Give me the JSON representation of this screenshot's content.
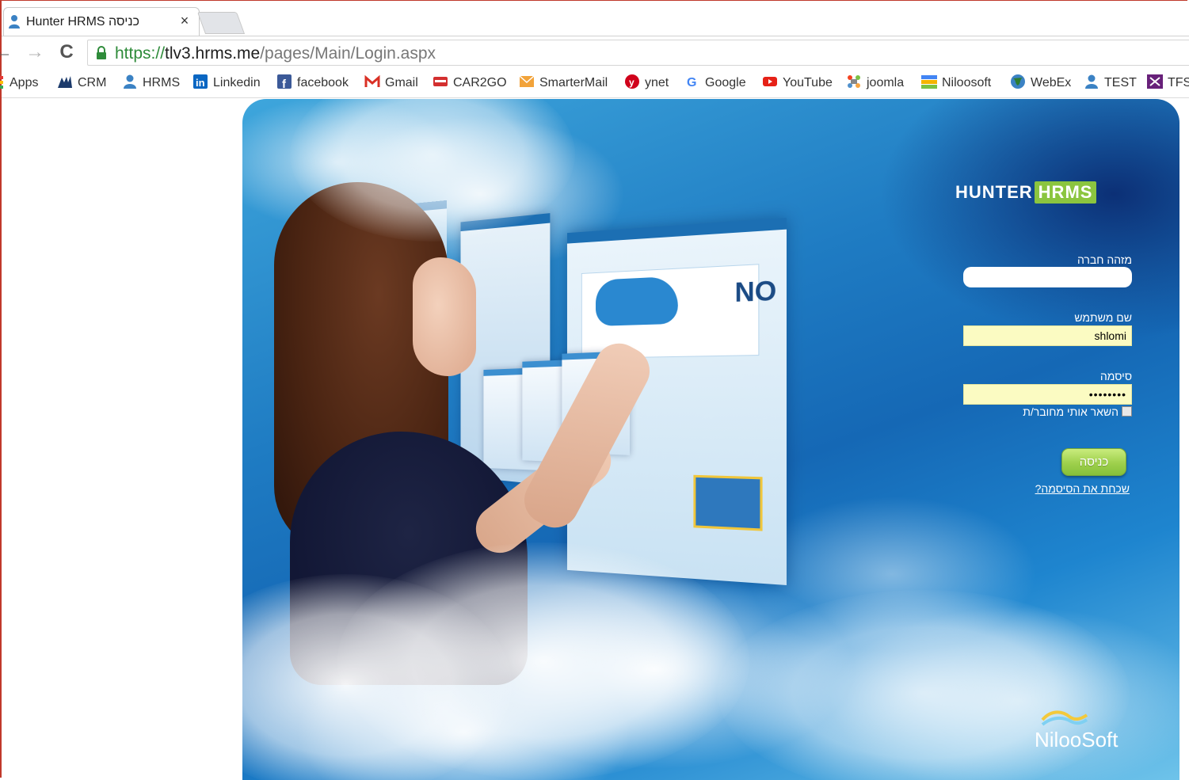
{
  "browser": {
    "tab": {
      "title": "Hunter HRMS כניסה",
      "close_glyph": "×"
    },
    "nav": {
      "back_glyph": "←",
      "forward_glyph": "→",
      "reload_glyph": "C"
    },
    "address": {
      "scheme": "https://",
      "host": "tlv3.hrms.me",
      "path": "/pages/Main/Login.aspx"
    },
    "bookmarks": [
      {
        "label": "Apps",
        "icon": "apps-grid-icon",
        "color": "#e53935"
      },
      {
        "label": "CRM",
        "icon": "dynamics-crm-icon",
        "color": "#1b3a6b"
      },
      {
        "label": "HRMS",
        "icon": "person-icon",
        "color": "#3b82c4"
      },
      {
        "label": "Linkedin",
        "icon": "linkedin-icon",
        "color": "#0a66c2"
      },
      {
        "label": "facebook",
        "icon": "facebook-icon",
        "color": "#3b5998"
      },
      {
        "label": "Gmail",
        "icon": "gmail-icon",
        "color": "#d93025"
      },
      {
        "label": "CAR2GO",
        "icon": "car2go-icon",
        "color": "#d32f2f"
      },
      {
        "label": "SmarterMail",
        "icon": "mail-envelope-icon",
        "color": "#f2a33a"
      },
      {
        "label": "ynet",
        "icon": "ynet-icon",
        "color": "#d0021b"
      },
      {
        "label": "Google",
        "icon": "google-icon",
        "color": "#4285f4"
      },
      {
        "label": "YouTube",
        "icon": "youtube-icon",
        "color": "#e62117"
      },
      {
        "label": "joomla",
        "icon": "joomla-icon",
        "color": "#f44321"
      },
      {
        "label": "Niloosoft",
        "icon": "niloosoft-icon",
        "color": "#f4b400"
      },
      {
        "label": "WebEx",
        "icon": "webex-globe-icon",
        "color": "#2e7d32"
      },
      {
        "label": "TEST",
        "icon": "person-icon",
        "color": "#3b82c4"
      },
      {
        "label": "TFS",
        "icon": "visual-studio-icon",
        "color": "#68217a"
      }
    ]
  },
  "login": {
    "logo_hunter": "HUNTER",
    "logo_hrms": "HRMS",
    "company_label": "מזהה חברה",
    "company_value": "",
    "username_label": "שם משתמש",
    "username_value": "shlomi",
    "password_label": "סיסמה",
    "password_value": "••••••••",
    "remember_label": "השאר אותי מחובר/ת",
    "remember_checked": false,
    "submit_label": "כניסה",
    "forgot_label": "שכחת את הסיסמה?",
    "vendor_logo": "NilooSoft",
    "promo_screen_text": "NO"
  },
  "colors": {
    "accent_green": "#8bc53f",
    "field_yellow": "#fbfbc2",
    "url_green": "#2e8b3a"
  }
}
